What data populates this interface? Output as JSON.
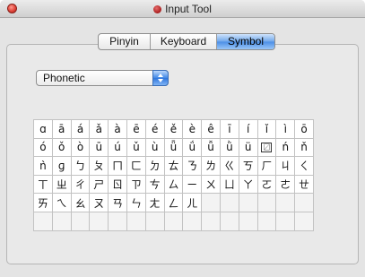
{
  "window": {
    "title": "Input Tool"
  },
  "tabs": [
    {
      "label": "Pinyin",
      "active": false
    },
    {
      "label": "Keyboard",
      "active": false
    },
    {
      "label": "Symbol",
      "active": true
    }
  ],
  "select": {
    "value": "Phonetic"
  },
  "symbols": [
    "ɑ",
    "ā",
    "á",
    "ǎ",
    "à",
    "ē",
    "é",
    "ě",
    "è",
    "ê",
    "ī",
    "í",
    "ǐ",
    "ì",
    "ō",
    "ó",
    "ǒ",
    "ò",
    "ū",
    "ú",
    "ǔ",
    "ù",
    "ǖ",
    "ǘ",
    "ǚ",
    "ǜ",
    "ü",
    "〼",
    "ń",
    "ň",
    "ǹ",
    "ɡ",
    "ㄅ",
    "ㄆ",
    "ㄇ",
    "ㄈ",
    "ㄉ",
    "ㄊ",
    "ㄋ",
    "ㄌ",
    "ㄍ",
    "ㄎ",
    "ㄏ",
    "ㄐ",
    "ㄑ",
    "ㄒ",
    "ㄓ",
    "ㄔ",
    "ㄕ",
    "ㄖ",
    "ㄗ",
    "ㄘ",
    "ㄙ",
    "ㄧ",
    "ㄨ",
    "ㄩ",
    "ㄚ",
    "ㄛ",
    "ㄜ",
    "ㄝ",
    "ㄞ",
    "ㄟ",
    "ㄠ",
    "ㄡ",
    "ㄢ",
    "ㄣ",
    "ㄤ",
    "ㄥ",
    "ㄦ",
    "",
    "",
    "",
    "",
    "",
    "",
    "",
    "",
    "",
    "",
    "",
    "",
    "",
    "",
    "",
    "",
    "",
    "",
    "",
    "",
    ""
  ],
  "colors": {
    "accent": "#4b8ee6",
    "close_button": "#e0443a"
  },
  "icons": {
    "close": "close-icon",
    "app": "app-icon",
    "popup_arrows": "updown-arrows-icon"
  }
}
